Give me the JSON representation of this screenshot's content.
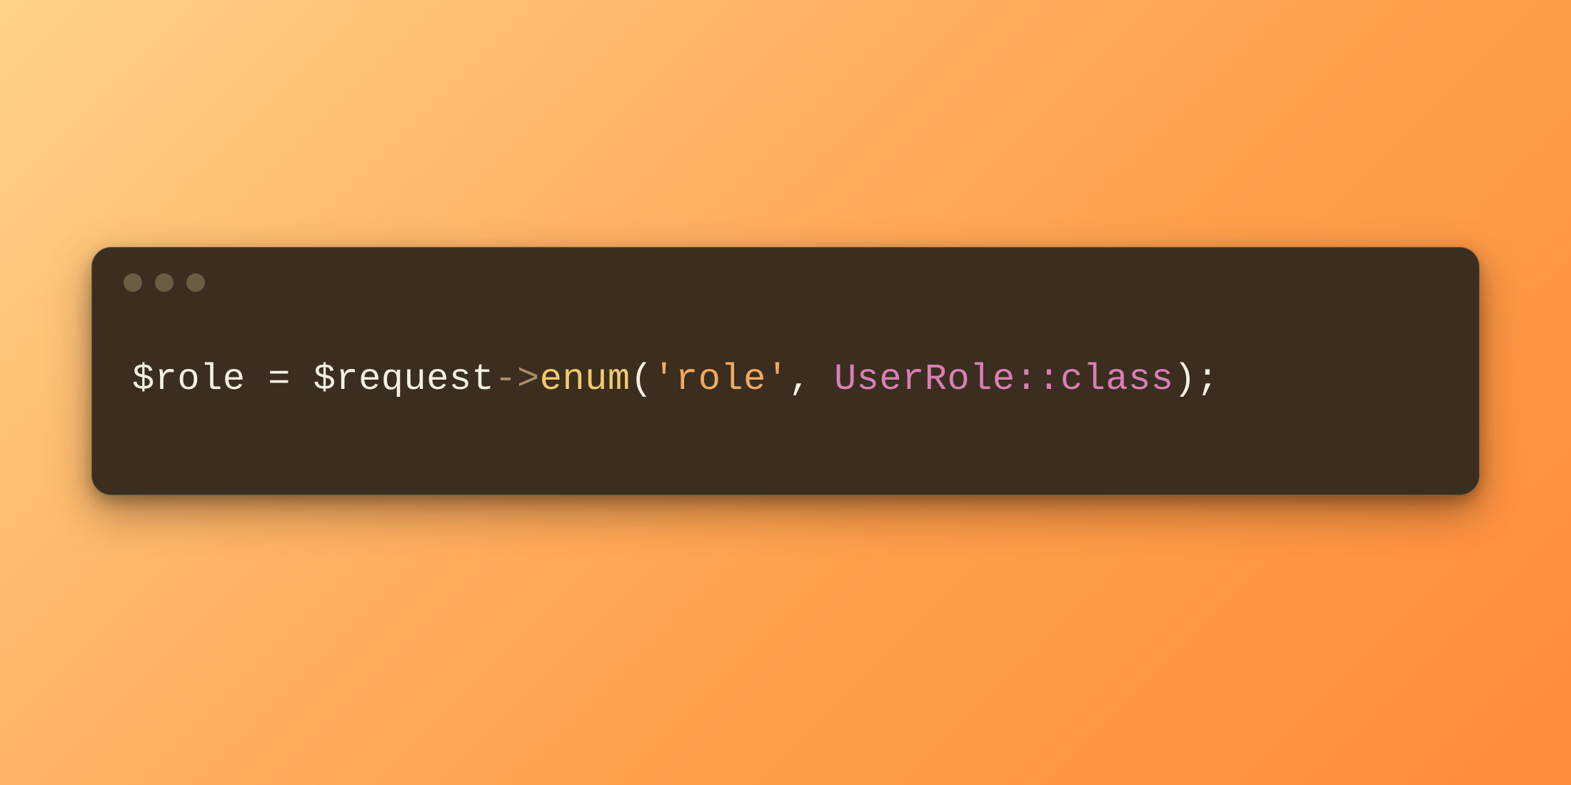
{
  "code": {
    "tokens": [
      {
        "text": "$role",
        "cls": "tok-var"
      },
      {
        "text": " ",
        "cls": "tok-op"
      },
      {
        "text": "=",
        "cls": "tok-op"
      },
      {
        "text": " ",
        "cls": "tok-op"
      },
      {
        "text": "$request",
        "cls": "tok-var"
      },
      {
        "text": "->",
        "cls": "tok-arrow"
      },
      {
        "text": "enum",
        "cls": "tok-method"
      },
      {
        "text": "(",
        "cls": "tok-paren"
      },
      {
        "text": "'role'",
        "cls": "tok-string"
      },
      {
        "text": ", ",
        "cls": "tok-punc"
      },
      {
        "text": "UserRole",
        "cls": "tok-class"
      },
      {
        "text": "::",
        "cls": "tok-scope"
      },
      {
        "text": "class",
        "cls": "tok-class"
      },
      {
        "text": ")",
        "cls": "tok-paren"
      },
      {
        "text": ";",
        "cls": "tok-punc"
      }
    ]
  }
}
